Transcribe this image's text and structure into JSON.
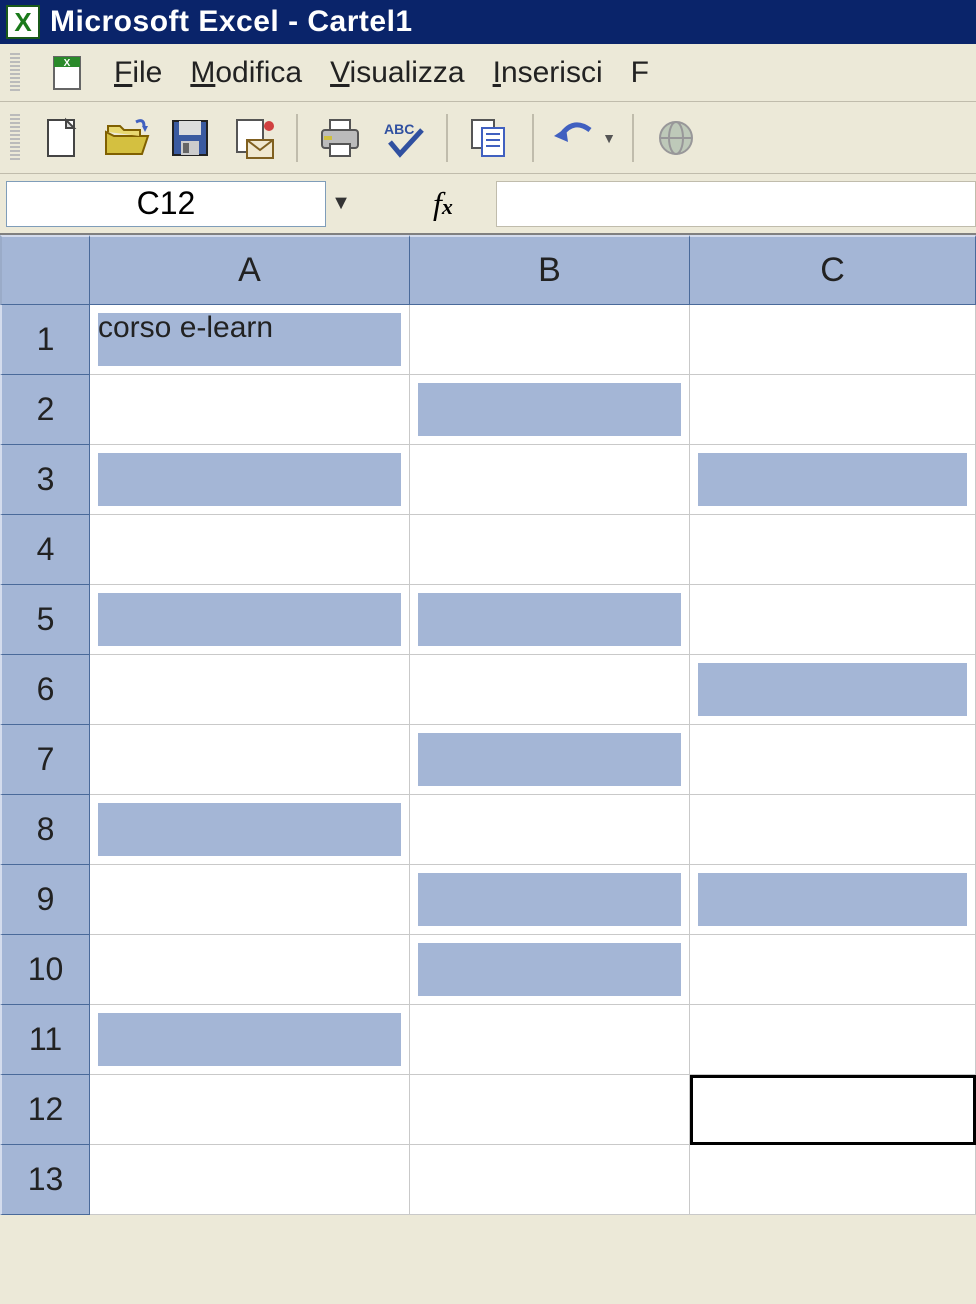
{
  "title": "Microsoft Excel - Cartel1",
  "menu": {
    "file": "File",
    "modifica": "Modifica",
    "visualizza": "Visualizza",
    "inserisci": "Inserisci",
    "f_partial": "F"
  },
  "toolbar": {
    "new": "new-document-icon",
    "open": "open-folder-icon",
    "save": "save-disk-icon",
    "mail": "send-mail-icon",
    "print": "print-icon",
    "spell": "spellcheck-icon",
    "copy": "copy-icon",
    "undo": "undo-icon",
    "web": "hyperlink-globe-icon"
  },
  "formula_bar": {
    "name_box": "C12",
    "fx_label": "fx",
    "formula": ""
  },
  "columns": [
    "A",
    "B",
    "C"
  ],
  "rows": [
    "1",
    "2",
    "3",
    "4",
    "5",
    "6",
    "7",
    "8",
    "9",
    "10",
    "11",
    "12",
    "13"
  ],
  "cells": {
    "A1": {
      "text": "corso e-learn",
      "fill": true
    },
    "B2": {
      "fill": true
    },
    "A3": {
      "fill": true
    },
    "C3": {
      "fill": true
    },
    "A5": {
      "fill": true
    },
    "B5": {
      "fill": true
    },
    "C6": {
      "fill": true
    },
    "B7": {
      "fill": true
    },
    "A8": {
      "fill": true
    },
    "B9": {
      "fill": true
    },
    "C9": {
      "fill": true
    },
    "B10": {
      "fill": true
    },
    "A11": {
      "fill": true
    }
  },
  "active_cell": "C12"
}
